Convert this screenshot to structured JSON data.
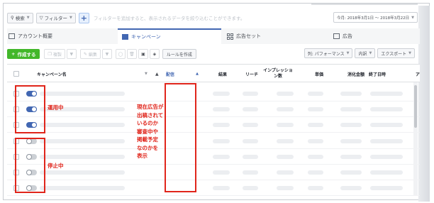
{
  "filter_bar": {
    "search_label": "検索",
    "filter_label": "フィルター",
    "hint": "フィルターを追加すると、表示されるデータを絞り込むことができます。",
    "date_range": "今月: 2018年3月1日 〜 2018年3月22日"
  },
  "tabs": [
    {
      "label": "アカウント概要",
      "icon": "account-icon"
    },
    {
      "label": "キャンペーン",
      "icon": "campaign-folder-icon"
    },
    {
      "label": "広告セット",
      "icon": "adset-grid-icon"
    },
    {
      "label": "広告",
      "icon": "ad-icon"
    }
  ],
  "toolbar": {
    "create_label": "作成する",
    "duplicate_label": "複製",
    "edit_label": "編集",
    "rule_label": "ルールを作成",
    "columns_label": "列: パフォーマンス",
    "breakdown_label": "内訳",
    "export_label": "エクスポート"
  },
  "table": {
    "columns": [
      {
        "key": "name",
        "label": "キャンペーン名"
      },
      {
        "key": "delivery",
        "label": "配信",
        "sorted": "asc"
      },
      {
        "key": "results",
        "label": "結果"
      },
      {
        "key": "reach",
        "label": "リーチ"
      },
      {
        "key": "impressions",
        "label": "インプレッション数"
      },
      {
        "key": "cost",
        "label": "単価"
      },
      {
        "key": "spent",
        "label": "消化金額"
      },
      {
        "key": "end_date",
        "label": "終了日時"
      },
      {
        "key": "extra",
        "label": "ア"
      }
    ],
    "rows": [
      {
        "status": "on"
      },
      {
        "status": "on"
      },
      {
        "status": "on"
      },
      {
        "status": "off"
      },
      {
        "status": "off"
      },
      {
        "status": "off"
      },
      {
        "status": "off"
      }
    ]
  },
  "annotations": {
    "active": "運用中",
    "paused": "停止中",
    "delivery_note": [
      "現在広告が",
      "出稿されて",
      "いるのか",
      "審査中や",
      "掲載予定",
      "なのかを",
      "表示"
    ]
  },
  "colors": {
    "accent": "#4267b2",
    "create": "#42b72a",
    "annotation": "#e0251b"
  }
}
